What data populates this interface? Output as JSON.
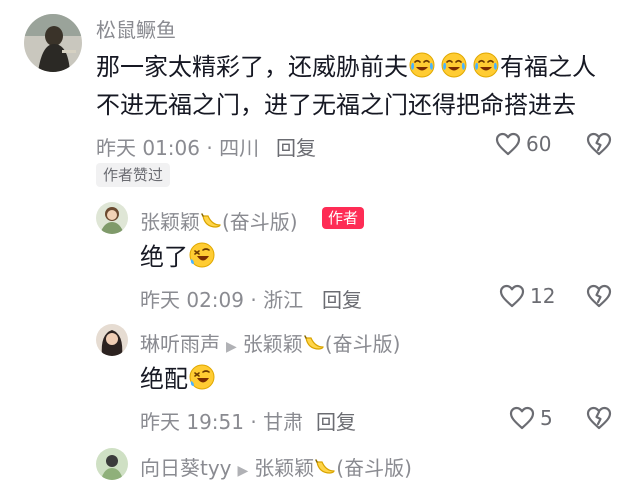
{
  "comments": [
    {
      "username": "松鼠鳜鱼",
      "text_line1_a": "那一家太精彩了，还威胁前夫",
      "text_line1_b": "有福之人",
      "text_line2": "不进无福之门，进了无福之门还得把命搭进去",
      "meta": "昨天 01:06 · 四川",
      "reply_label": "回复",
      "likes": "60",
      "badge": "作者赞过"
    },
    {
      "username": "张颖颖",
      "name_suffix": "(奋斗版)",
      "author_tag": "作者",
      "text": "绝了",
      "meta": "昨天 02:09 · 浙江",
      "reply_label": "回复",
      "likes": "12"
    },
    {
      "username": "琳听雨声",
      "reply_to": "张颖颖",
      "reply_to_suffix": "(奋斗版)",
      "text": "绝配",
      "meta": "昨天 19:51 · 甘肃",
      "reply_label": "回复",
      "likes": "5"
    },
    {
      "username": "向日葵tyy",
      "reply_to": "张颖颖",
      "reply_to_suffix": "(奋斗版)"
    }
  ],
  "icons": {
    "like": "heart-outline-icon",
    "dislike": "broken-heart-icon",
    "reply_arrow": "play-triangle-icon",
    "emoji_cry": "tears-of-joy-emoji",
    "emoji_lol": "rolling-laugh-emoji",
    "banana": "banana-icon"
  },
  "colors": {
    "text": "#161823",
    "muted": "#8a8b91",
    "author_tag": "#fe2c55"
  }
}
